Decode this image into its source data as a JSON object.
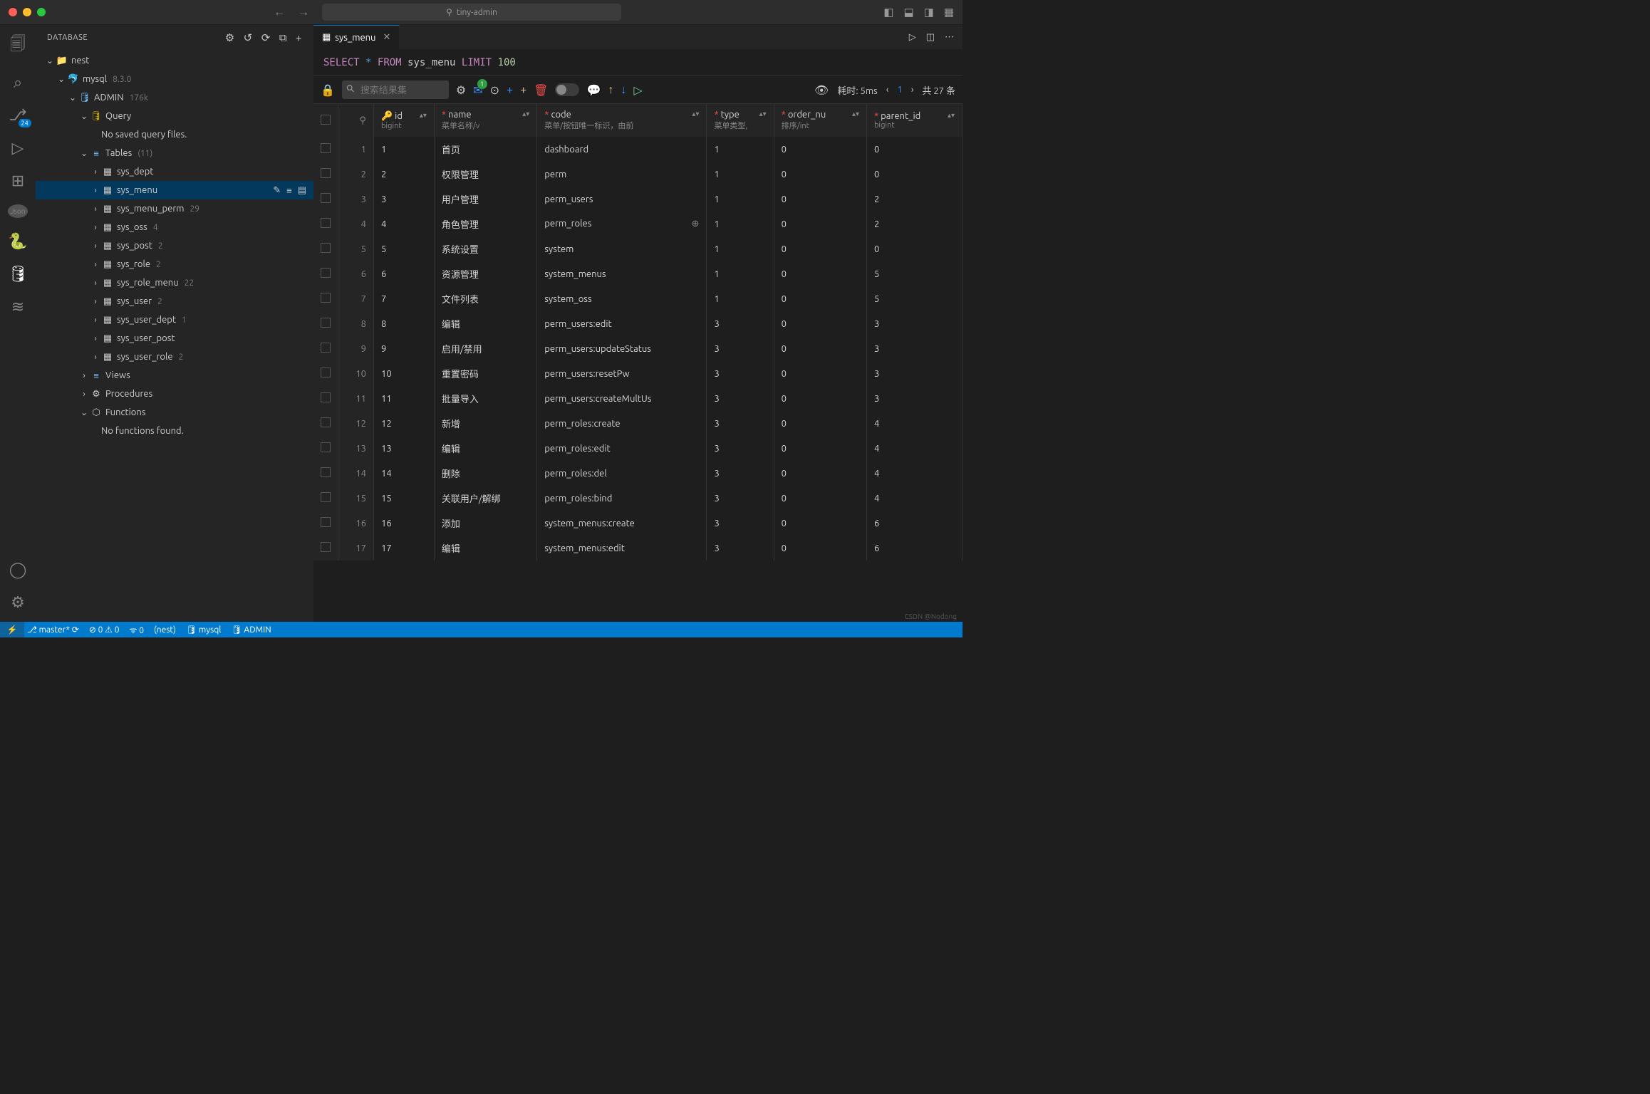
{
  "titlebar": {
    "search_label": "tiny-admin"
  },
  "activity": {
    "scm_badge": "24"
  },
  "sidebar": {
    "title": "DATABASE",
    "root": {
      "label": "nest"
    },
    "server": {
      "label": "mysql",
      "version": "8.3.0"
    },
    "db": {
      "label": "ADMIN",
      "size": "176k"
    },
    "query_label": "Query",
    "no_query": "No saved query files.",
    "tables_label": "Tables",
    "tables_count": "(11)",
    "tables": [
      {
        "name": "sys_dept",
        "count": null
      },
      {
        "name": "sys_menu",
        "count": null,
        "selected": true
      },
      {
        "name": "sys_menu_perm",
        "count": "29"
      },
      {
        "name": "sys_oss",
        "count": "4"
      },
      {
        "name": "sys_post",
        "count": "2"
      },
      {
        "name": "sys_role",
        "count": "2"
      },
      {
        "name": "sys_role_menu",
        "count": "22"
      },
      {
        "name": "sys_user",
        "count": "2"
      },
      {
        "name": "sys_user_dept",
        "count": "1"
      },
      {
        "name": "sys_user_post",
        "count": null
      },
      {
        "name": "sys_user_role",
        "count": "2"
      }
    ],
    "views_label": "Views",
    "procedures_label": "Procedures",
    "functions_label": "Functions",
    "no_functions": "No functions found."
  },
  "tab": {
    "title": "sys_menu"
  },
  "sql": {
    "select": "SELECT",
    "star": "*",
    "from": "FROM",
    "tbl": "sys_menu",
    "limit": "LIMIT",
    "n": "100"
  },
  "toolbar": {
    "search_ph": "搜索结果集",
    "mail_badge": "1",
    "time_label": "耗时: 5ms",
    "page": "1",
    "total": "共 27 条"
  },
  "columns": [
    {
      "name": "id",
      "sub": "bigint",
      "key": true
    },
    {
      "name": "name",
      "sub": "菜单名称/v",
      "req": true
    },
    {
      "name": "code",
      "sub": "菜单/按钮唯一标识，由前",
      "req": true
    },
    {
      "name": "type",
      "sub": "菜单类型,",
      "req": true
    },
    {
      "name": "order_nu",
      "sub": "排序/int",
      "req": true
    },
    {
      "name": "parent_id",
      "sub": "bigint",
      "req": true
    }
  ],
  "rows": [
    {
      "n": "1",
      "id": "1",
      "name": "首页",
      "code": "dashboard",
      "type": "1",
      "order": "0",
      "parent": "0"
    },
    {
      "n": "2",
      "id": "2",
      "name": "权限管理",
      "code": "perm",
      "type": "1",
      "order": "0",
      "parent": "0"
    },
    {
      "n": "3",
      "id": "3",
      "name": "用户管理",
      "code": "perm_users",
      "type": "1",
      "order": "0",
      "parent": "2"
    },
    {
      "n": "4",
      "id": "4",
      "name": "角色管理",
      "code": "perm_roles",
      "type": "1",
      "order": "0",
      "parent": "2",
      "zoom": true
    },
    {
      "n": "5",
      "id": "5",
      "name": "系统设置",
      "code": "system",
      "type": "1",
      "order": "0",
      "parent": "0"
    },
    {
      "n": "6",
      "id": "6",
      "name": "资源管理",
      "code": "system_menus",
      "type": "1",
      "order": "0",
      "parent": "5"
    },
    {
      "n": "7",
      "id": "7",
      "name": "文件列表",
      "code": "system_oss",
      "type": "1",
      "order": "0",
      "parent": "5"
    },
    {
      "n": "8",
      "id": "8",
      "name": "编辑",
      "code": "perm_users:edit",
      "type": "3",
      "order": "0",
      "parent": "3"
    },
    {
      "n": "9",
      "id": "9",
      "name": "启用/禁用",
      "code": "perm_users:updateStatus",
      "type": "3",
      "order": "0",
      "parent": "3"
    },
    {
      "n": "10",
      "id": "10",
      "name": "重置密码",
      "code": "perm_users:resetPw",
      "type": "3",
      "order": "0",
      "parent": "3"
    },
    {
      "n": "11",
      "id": "11",
      "name": "批量导入",
      "code": "perm_users:createMultUs",
      "type": "3",
      "order": "0",
      "parent": "3"
    },
    {
      "n": "12",
      "id": "12",
      "name": "新增",
      "code": "perm_roles:create",
      "type": "3",
      "order": "0",
      "parent": "4"
    },
    {
      "n": "13",
      "id": "13",
      "name": "编辑",
      "code": "perm_roles:edit",
      "type": "3",
      "order": "0",
      "parent": "4"
    },
    {
      "n": "14",
      "id": "14",
      "name": "删除",
      "code": "perm_roles:del",
      "type": "3",
      "order": "0",
      "parent": "4"
    },
    {
      "n": "15",
      "id": "15",
      "name": "关联用户/解绑",
      "code": "perm_roles:bind",
      "type": "3",
      "order": "0",
      "parent": "4"
    },
    {
      "n": "16",
      "id": "16",
      "name": "添加",
      "code": "system_menus:create",
      "type": "3",
      "order": "0",
      "parent": "6"
    },
    {
      "n": "17",
      "id": "17",
      "name": "编辑",
      "code": "system_menus:edit",
      "type": "3",
      "order": "0",
      "parent": "6"
    }
  ],
  "status": {
    "branch": "master*",
    "errors": "0",
    "warnings": "0",
    "port": "0",
    "db_label": "(nest)",
    "server": "mysql",
    "db": "ADMIN"
  },
  "watermark": "CSDN @Nodong"
}
